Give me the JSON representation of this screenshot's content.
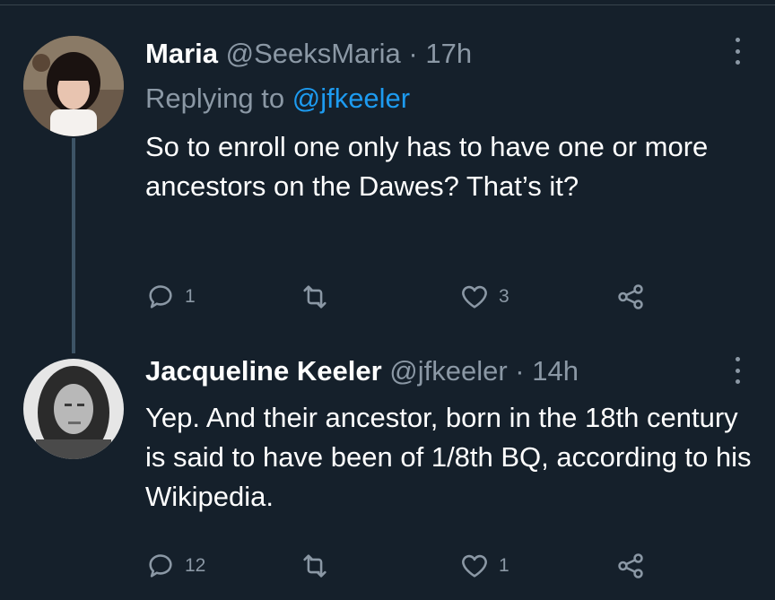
{
  "tweets": [
    {
      "name": "Maria",
      "handle": "@SeeksMaria",
      "separator": "·",
      "time": "17h",
      "replying_prefix": "Replying to",
      "replying_to": "@jfkeeler",
      "text": "So to enroll one only has to have one or more ancestors on the Dawes? That’s it?",
      "replies": "1",
      "retweets": "",
      "likes": "3"
    },
    {
      "name": "Jacqueline Keeler",
      "handle": "@jfkeeler",
      "separator": "·",
      "time": "14h",
      "text": "Yep. And their ancestor, born in the 18th century is said to have been of 1/8th BQ, according to his Wikipedia.",
      "replies": "12",
      "retweets": "",
      "likes": "1"
    }
  ],
  "colors": {
    "background": "#15202b",
    "muted": "#8b98a5",
    "link": "#1d9bf0",
    "thread_line": "#3d5466"
  },
  "icons": [
    "reply-icon",
    "retweet-icon",
    "like-icon",
    "share-icon",
    "more-icon"
  ]
}
